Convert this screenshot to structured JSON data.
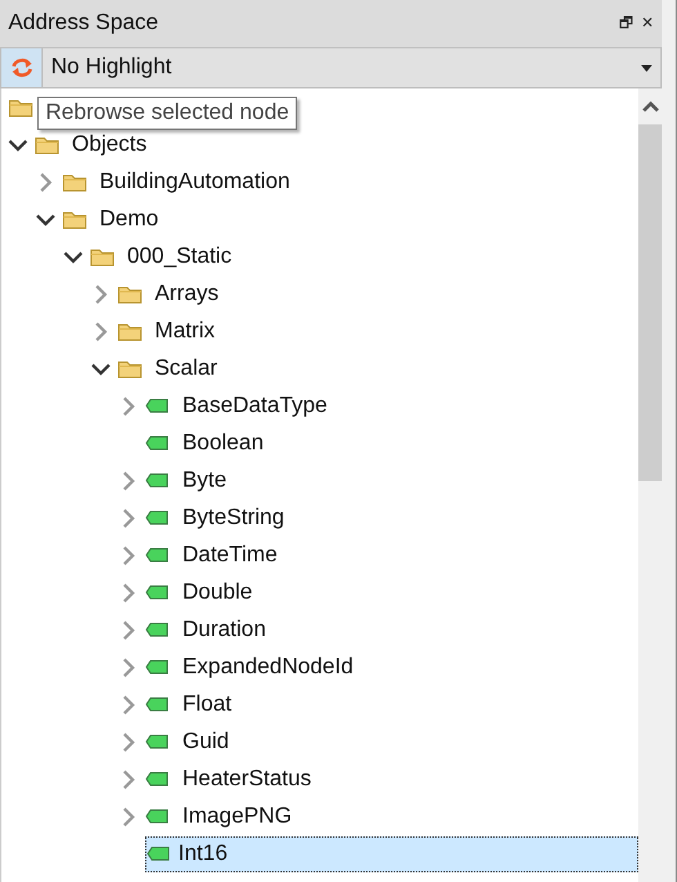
{
  "panel": {
    "title": "Address Space",
    "restore": "🗗",
    "close": "✕"
  },
  "toolbar": {
    "highlight": "No Highlight"
  },
  "tooltip": "Rebrowse selected node",
  "tree": [
    {
      "kind": "root",
      "children": [
        {
          "kind": "folder",
          "label": "Objects",
          "expanded": true,
          "selected": false,
          "children": [
            {
              "kind": "folder",
              "label": "BuildingAutomation",
              "expanded": false,
              "selected": false
            },
            {
              "kind": "folder",
              "label": "Demo",
              "expanded": true,
              "selected": false,
              "children": [
                {
                  "kind": "folder",
                  "label": "000_Static",
                  "expanded": true,
                  "selected": false,
                  "children": [
                    {
                      "kind": "folder",
                      "label": "Arrays",
                      "expanded": false,
                      "selected": false
                    },
                    {
                      "kind": "folder",
                      "label": "Matrix",
                      "expanded": false,
                      "selected": false
                    },
                    {
                      "kind": "folder",
                      "label": "Scalar",
                      "expanded": true,
                      "selected": false,
                      "children": [
                        {
                          "kind": "variable",
                          "label": "BaseDataType",
                          "expanded": false,
                          "selected": false
                        },
                        {
                          "kind": "variable",
                          "label": "Boolean",
                          "selected": false
                        },
                        {
                          "kind": "variable",
                          "label": "Byte",
                          "expanded": false,
                          "selected": false
                        },
                        {
                          "kind": "variable",
                          "label": "ByteString",
                          "expanded": false,
                          "selected": false
                        },
                        {
                          "kind": "variable",
                          "label": "DateTime",
                          "expanded": false,
                          "selected": false
                        },
                        {
                          "kind": "variable",
                          "label": "Double",
                          "expanded": false,
                          "selected": false
                        },
                        {
                          "kind": "variable",
                          "label": "Duration",
                          "expanded": false,
                          "selected": false
                        },
                        {
                          "kind": "variable",
                          "label": "ExpandedNodeId",
                          "expanded": false,
                          "selected": false
                        },
                        {
                          "kind": "variable",
                          "label": "Float",
                          "expanded": false,
                          "selected": false
                        },
                        {
                          "kind": "variable",
                          "label": "Guid",
                          "expanded": false,
                          "selected": false
                        },
                        {
                          "kind": "variable",
                          "label": "HeaterStatus",
                          "expanded": false,
                          "selected": false
                        },
                        {
                          "kind": "variable",
                          "label": "ImagePNG",
                          "expanded": false,
                          "selected": false
                        },
                        {
                          "kind": "variable",
                          "label": "Int16",
                          "selected": true
                        }
                      ]
                    }
                  ]
                }
              ]
            }
          ]
        }
      ]
    }
  ]
}
